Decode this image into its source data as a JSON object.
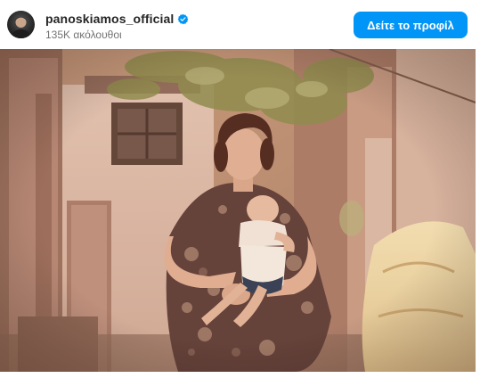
{
  "post_header": {
    "username": "panoskiamos_official",
    "followers_text": "135K ακόλουθοι",
    "view_profile_label": "Δείτε το προφίλ",
    "verified_icon": "verified-badge-icon",
    "accent_color": "#0095f6"
  },
  "photo": {
    "description_icon": "vintage-photo"
  }
}
